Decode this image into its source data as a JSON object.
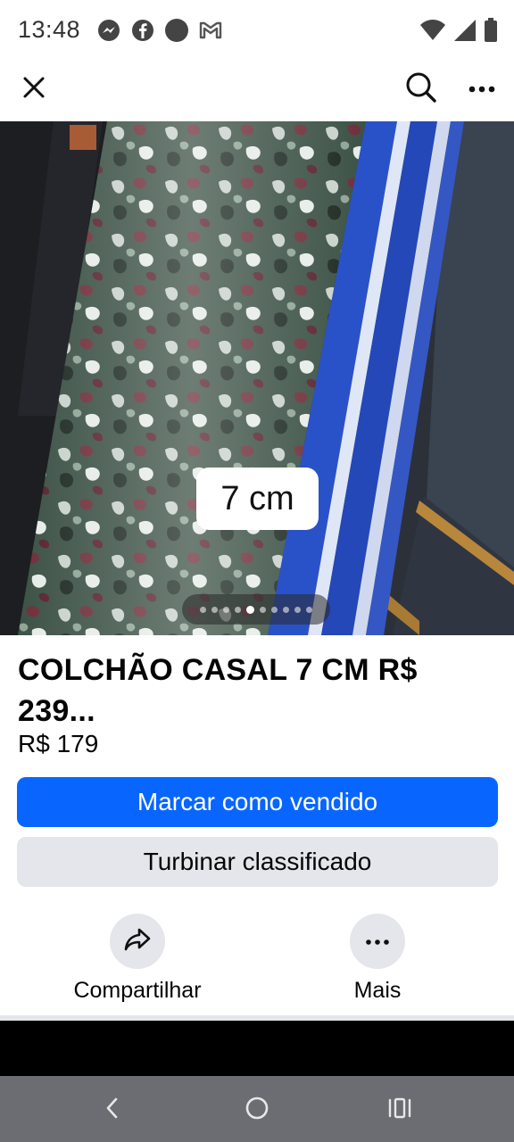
{
  "status_bar": {
    "time": "13:48",
    "notifications": [
      "messenger-icon",
      "facebook-icon",
      "circle-icon",
      "gmail-icon"
    ],
    "system": [
      "wifi-icon",
      "signal-icon",
      "battery-icon"
    ]
  },
  "nav": {
    "close_icon": "close-icon",
    "search_icon": "search-icon",
    "more_icon": "more-icon"
  },
  "photo": {
    "overlay_label": "7 cm",
    "image_count": 10,
    "active_index": 4
  },
  "listing": {
    "title": "COLCHÃO CASAL 7 CM R$ 239...",
    "price": "R$ 179"
  },
  "buttons": {
    "mark_sold": "Marcar como vendido",
    "boost": "Turbinar classificado"
  },
  "actions": {
    "share": "Compartilhar",
    "more": "Mais"
  },
  "colors": {
    "primary": "#0866ff",
    "secondary_bg": "#e4e6eb"
  }
}
